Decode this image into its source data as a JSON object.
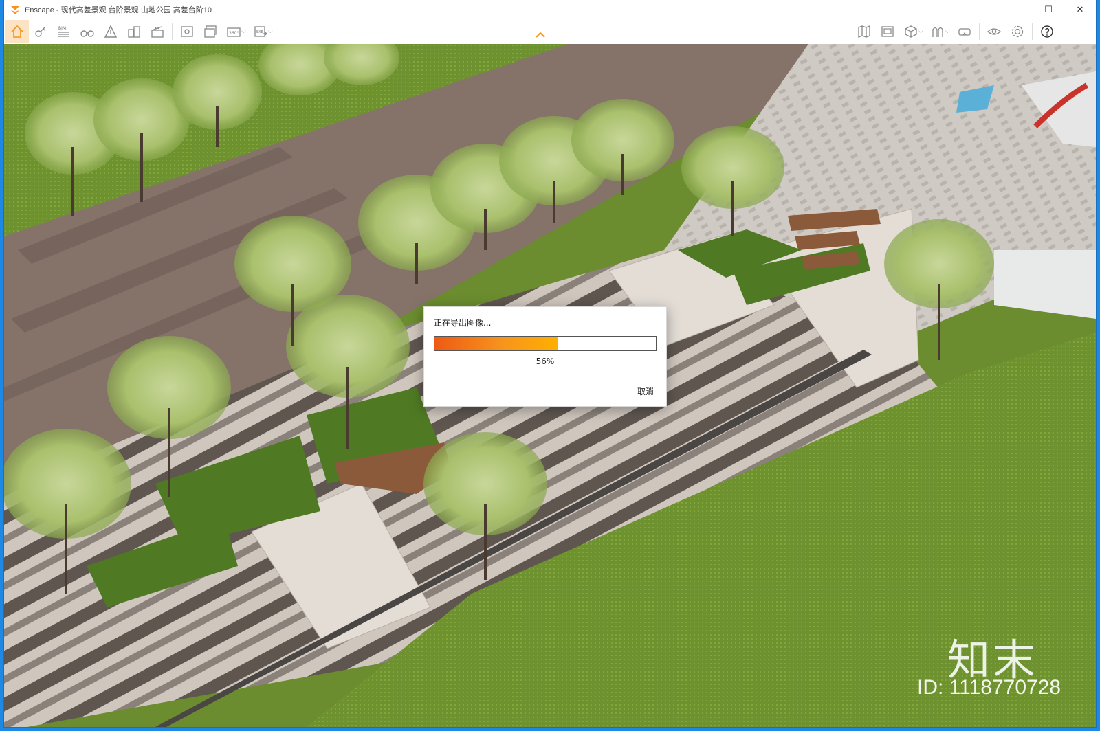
{
  "window": {
    "title": "Enscape - 现代高差景观 台阶景观 山地公园 高差台阶10",
    "controls": [
      "minimize-icon",
      "maximize-icon",
      "close-icon"
    ]
  },
  "toolbar": {
    "left_icons": [
      "home-icon",
      "key-icon",
      "bim-icon",
      "binoculars-icon",
      "navigation-icon",
      "buildings-icon",
      "clapboard-icon",
      "screenshot-export-icon",
      "batch-render-icon",
      "panorama-360-icon",
      "exe-export-icon"
    ],
    "bim_label": "BIM",
    "pano_label": "360°",
    "exe_label": "EXE",
    "right_icons": [
      "map-icon",
      "gallery-icon",
      "cube-icon",
      "asset-library-icon",
      "vr-headset-icon",
      "eye-icon",
      "settings-icon",
      "help-icon"
    ],
    "accent_color": "#f7941d"
  },
  "dialog": {
    "title": "正在导出图像...",
    "progress": 0.56,
    "progress_label": "56%",
    "cancel_label": "取消"
  },
  "watermark": {
    "logo": "知末",
    "id_text": "ID: 1118770728"
  }
}
